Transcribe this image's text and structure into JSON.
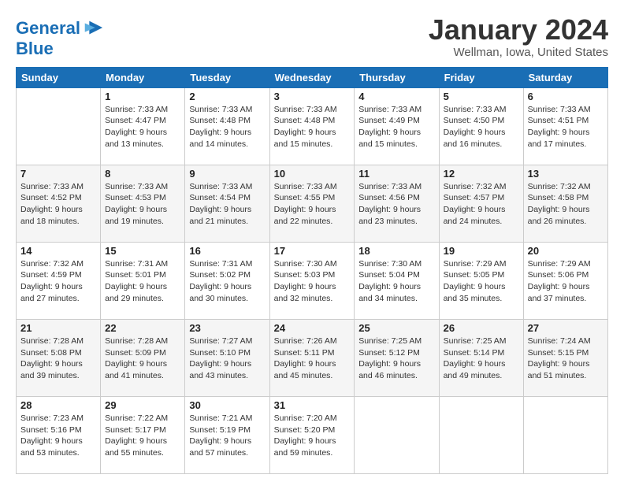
{
  "header": {
    "logo_line1": "General",
    "logo_line2": "Blue",
    "month": "January 2024",
    "location": "Wellman, Iowa, United States"
  },
  "weekdays": [
    "Sunday",
    "Monday",
    "Tuesday",
    "Wednesday",
    "Thursday",
    "Friday",
    "Saturday"
  ],
  "weeks": [
    [
      {
        "day": "",
        "detail": ""
      },
      {
        "day": "1",
        "detail": "Sunrise: 7:33 AM\nSunset: 4:47 PM\nDaylight: 9 hours\nand 13 minutes."
      },
      {
        "day": "2",
        "detail": "Sunrise: 7:33 AM\nSunset: 4:48 PM\nDaylight: 9 hours\nand 14 minutes."
      },
      {
        "day": "3",
        "detail": "Sunrise: 7:33 AM\nSunset: 4:48 PM\nDaylight: 9 hours\nand 15 minutes."
      },
      {
        "day": "4",
        "detail": "Sunrise: 7:33 AM\nSunset: 4:49 PM\nDaylight: 9 hours\nand 15 minutes."
      },
      {
        "day": "5",
        "detail": "Sunrise: 7:33 AM\nSunset: 4:50 PM\nDaylight: 9 hours\nand 16 minutes."
      },
      {
        "day": "6",
        "detail": "Sunrise: 7:33 AM\nSunset: 4:51 PM\nDaylight: 9 hours\nand 17 minutes."
      }
    ],
    [
      {
        "day": "7",
        "detail": "Sunrise: 7:33 AM\nSunset: 4:52 PM\nDaylight: 9 hours\nand 18 minutes."
      },
      {
        "day": "8",
        "detail": "Sunrise: 7:33 AM\nSunset: 4:53 PM\nDaylight: 9 hours\nand 19 minutes."
      },
      {
        "day": "9",
        "detail": "Sunrise: 7:33 AM\nSunset: 4:54 PM\nDaylight: 9 hours\nand 21 minutes."
      },
      {
        "day": "10",
        "detail": "Sunrise: 7:33 AM\nSunset: 4:55 PM\nDaylight: 9 hours\nand 22 minutes."
      },
      {
        "day": "11",
        "detail": "Sunrise: 7:33 AM\nSunset: 4:56 PM\nDaylight: 9 hours\nand 23 minutes."
      },
      {
        "day": "12",
        "detail": "Sunrise: 7:32 AM\nSunset: 4:57 PM\nDaylight: 9 hours\nand 24 minutes."
      },
      {
        "day": "13",
        "detail": "Sunrise: 7:32 AM\nSunset: 4:58 PM\nDaylight: 9 hours\nand 26 minutes."
      }
    ],
    [
      {
        "day": "14",
        "detail": "Sunrise: 7:32 AM\nSunset: 4:59 PM\nDaylight: 9 hours\nand 27 minutes."
      },
      {
        "day": "15",
        "detail": "Sunrise: 7:31 AM\nSunset: 5:01 PM\nDaylight: 9 hours\nand 29 minutes."
      },
      {
        "day": "16",
        "detail": "Sunrise: 7:31 AM\nSunset: 5:02 PM\nDaylight: 9 hours\nand 30 minutes."
      },
      {
        "day": "17",
        "detail": "Sunrise: 7:30 AM\nSunset: 5:03 PM\nDaylight: 9 hours\nand 32 minutes."
      },
      {
        "day": "18",
        "detail": "Sunrise: 7:30 AM\nSunset: 5:04 PM\nDaylight: 9 hours\nand 34 minutes."
      },
      {
        "day": "19",
        "detail": "Sunrise: 7:29 AM\nSunset: 5:05 PM\nDaylight: 9 hours\nand 35 minutes."
      },
      {
        "day": "20",
        "detail": "Sunrise: 7:29 AM\nSunset: 5:06 PM\nDaylight: 9 hours\nand 37 minutes."
      }
    ],
    [
      {
        "day": "21",
        "detail": "Sunrise: 7:28 AM\nSunset: 5:08 PM\nDaylight: 9 hours\nand 39 minutes."
      },
      {
        "day": "22",
        "detail": "Sunrise: 7:28 AM\nSunset: 5:09 PM\nDaylight: 9 hours\nand 41 minutes."
      },
      {
        "day": "23",
        "detail": "Sunrise: 7:27 AM\nSunset: 5:10 PM\nDaylight: 9 hours\nand 43 minutes."
      },
      {
        "day": "24",
        "detail": "Sunrise: 7:26 AM\nSunset: 5:11 PM\nDaylight: 9 hours\nand 45 minutes."
      },
      {
        "day": "25",
        "detail": "Sunrise: 7:25 AM\nSunset: 5:12 PM\nDaylight: 9 hours\nand 46 minutes."
      },
      {
        "day": "26",
        "detail": "Sunrise: 7:25 AM\nSunset: 5:14 PM\nDaylight: 9 hours\nand 49 minutes."
      },
      {
        "day": "27",
        "detail": "Sunrise: 7:24 AM\nSunset: 5:15 PM\nDaylight: 9 hours\nand 51 minutes."
      }
    ],
    [
      {
        "day": "28",
        "detail": "Sunrise: 7:23 AM\nSunset: 5:16 PM\nDaylight: 9 hours\nand 53 minutes."
      },
      {
        "day": "29",
        "detail": "Sunrise: 7:22 AM\nSunset: 5:17 PM\nDaylight: 9 hours\nand 55 minutes."
      },
      {
        "day": "30",
        "detail": "Sunrise: 7:21 AM\nSunset: 5:19 PM\nDaylight: 9 hours\nand 57 minutes."
      },
      {
        "day": "31",
        "detail": "Sunrise: 7:20 AM\nSunset: 5:20 PM\nDaylight: 9 hours\nand 59 minutes."
      },
      {
        "day": "",
        "detail": ""
      },
      {
        "day": "",
        "detail": ""
      },
      {
        "day": "",
        "detail": ""
      }
    ]
  ]
}
